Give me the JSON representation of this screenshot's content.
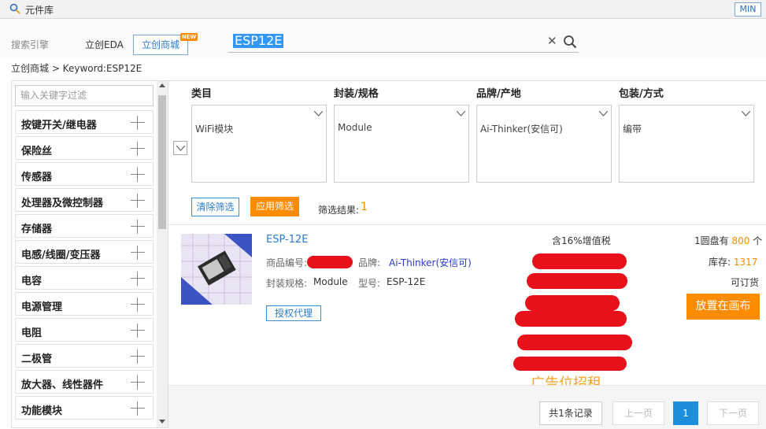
{
  "window": {
    "title": "元件库",
    "min_label": "MIN"
  },
  "search": {
    "engine_label": "搜索引擎",
    "tab_eda": "立创EDA",
    "tab_mall": "立创商城",
    "new_badge": "NEW",
    "query": "ESP12E"
  },
  "breadcrumb": "立创商城 > Keyword:ESP12E",
  "sidebar": {
    "filter_placeholder": "输入关键字过滤",
    "items": [
      {
        "label": "按键开关/继电器"
      },
      {
        "label": "保险丝"
      },
      {
        "label": "传感器"
      },
      {
        "label": "处理器及微控制器"
      },
      {
        "label": "存储器"
      },
      {
        "label": "电感/线圈/变压器"
      },
      {
        "label": "电容"
      },
      {
        "label": "电源管理"
      },
      {
        "label": "电阻"
      },
      {
        "label": "二极管"
      },
      {
        "label": "放大器、线性器件"
      },
      {
        "label": "功能模块"
      }
    ]
  },
  "filters": {
    "columns": [
      {
        "header": "类目",
        "option": "WiFi模块"
      },
      {
        "header": "封装/规格",
        "option": "Module"
      },
      {
        "header": "品牌/产地",
        "option": "Ai-Thinker(安信可)"
      },
      {
        "header": "包装/方式",
        "option": "编带"
      }
    ],
    "clear_label": "清除筛选",
    "apply_label": "应用筛选",
    "result_label": "筛选结果:",
    "result_count": "1"
  },
  "product": {
    "name": "ESP-12E",
    "code_label": "商品编号:",
    "brand_label": "品牌:",
    "brand_value": "Ai-Thinker(安信可)",
    "package_label": "封装规格:",
    "package_value": "Module",
    "model_label": "型号:",
    "model_value": "ESP-12E",
    "auth_label": "授权代理",
    "tax_label": "含16%增值税",
    "reel_prefix": "1圆盘有",
    "reel_count": "800",
    "reel_suffix": "个",
    "stock_label": "库存:",
    "stock_value": "1317",
    "order_label": "可订货",
    "place_label": "放置在画布",
    "ad_text": "广告位招租"
  },
  "pager": {
    "total": "共1条记录",
    "prev": "上一页",
    "current": "1",
    "next": "下一页"
  }
}
